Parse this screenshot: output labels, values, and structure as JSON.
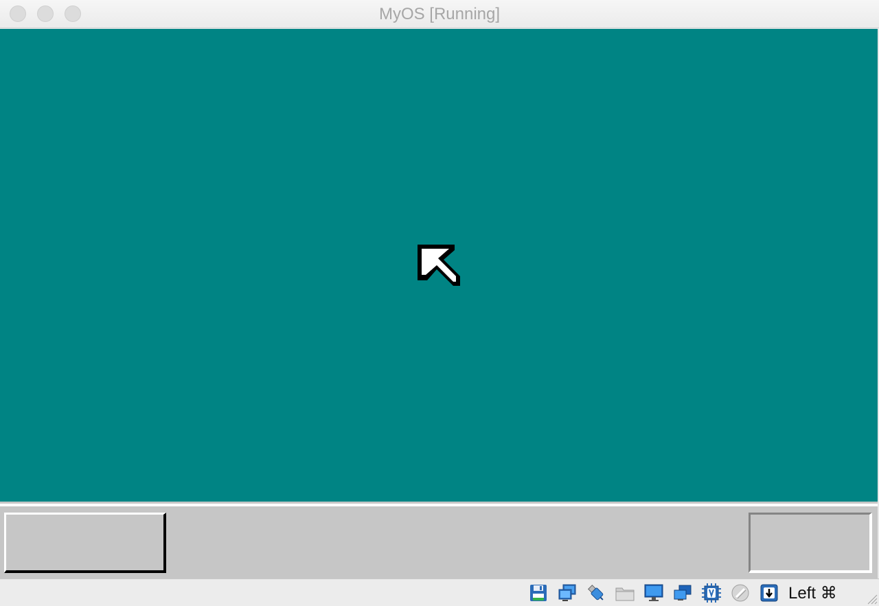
{
  "window": {
    "title": "MyOS [Running]"
  },
  "guest": {
    "desktop_color": "#008484",
    "taskbar_color": "#c6c6c6"
  },
  "statusbar": {
    "icons": [
      "floppy-disk-icon",
      "network-adapter-icon",
      "usb-icon",
      "shared-folder-icon",
      "display-icon",
      "video-capture-icon",
      "cpu-virtualization-icon",
      "mouse-integration-icon",
      "keyboard-capture-icon"
    ],
    "host_key_label": "Left ⌘"
  }
}
